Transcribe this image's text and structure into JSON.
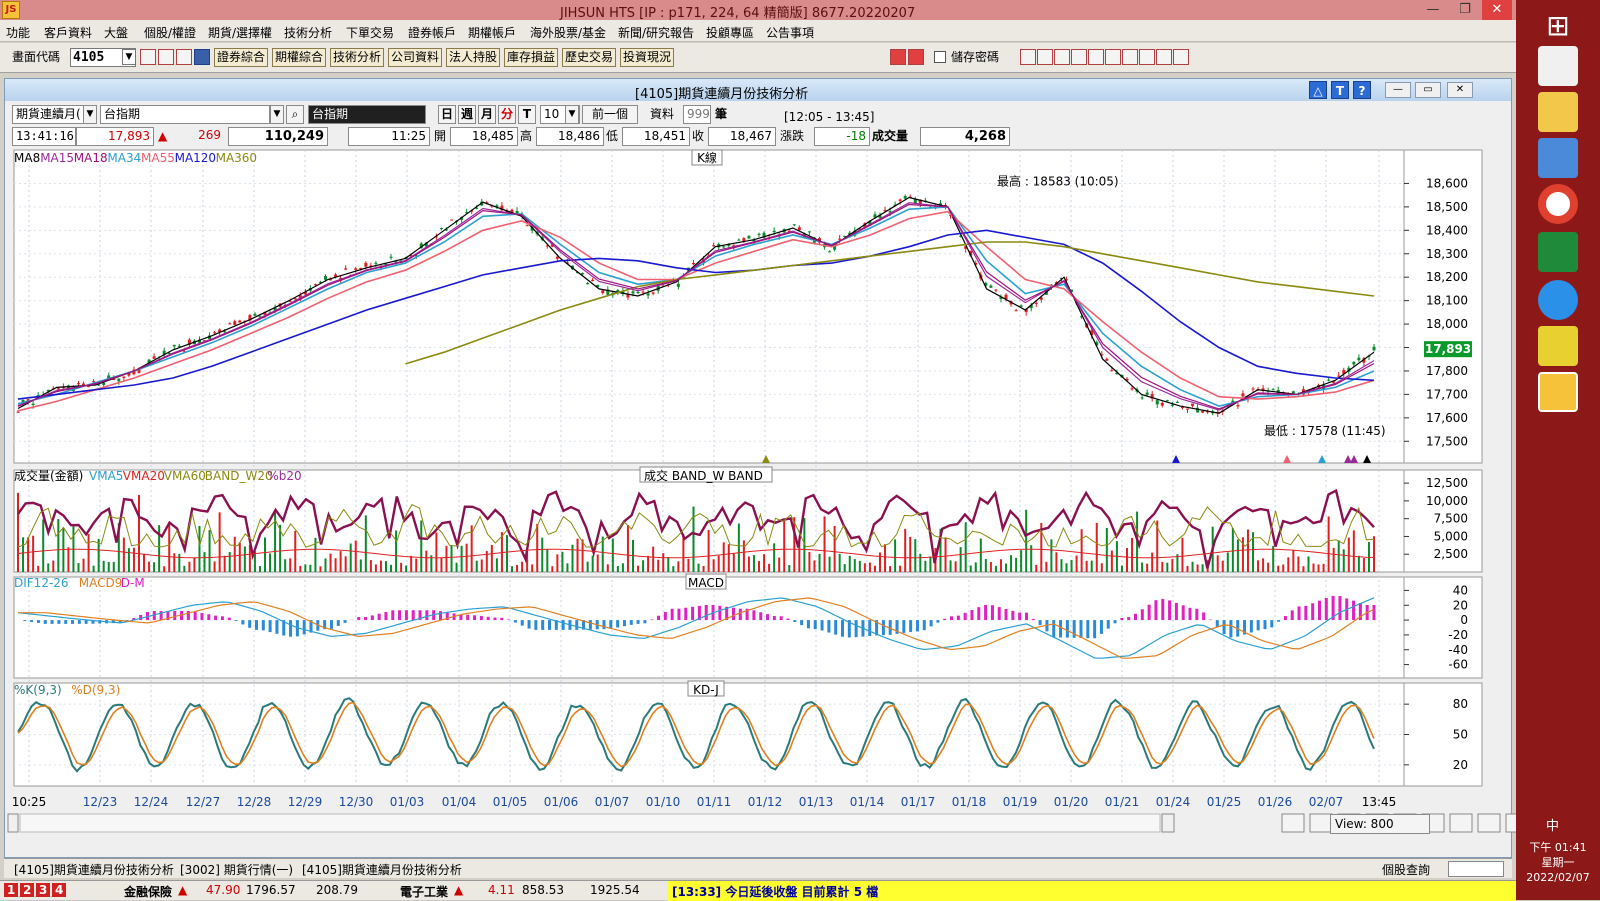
{
  "window": {
    "title": "JIHSUN HTS      [IP : p171, 224, 64 精簡版] 8677.20220207",
    "controls": [
      "—",
      "❐",
      "✕"
    ]
  },
  "menu": [
    "功能",
    "客戶資料",
    "大盤",
    "個股/權證",
    "期貨/選擇權",
    "技術分析",
    "下單交易",
    "證券帳戶",
    "期權帳戶",
    "海外股票/基金",
    "新聞/研究報告",
    "投顧專區",
    "公告事項"
  ],
  "toolbar": {
    "code_label": "畫面代碼",
    "code_value": "4105",
    "buttons": [
      "證券綜合",
      "期權綜合",
      "技術分析",
      "公司資料",
      "法人持股",
      "庫存損益",
      "歷史交易",
      "投資現況"
    ],
    "save_password_label": "儲存密碼"
  },
  "subwindow": {
    "title": "[4105]期貨連續月份技術分析",
    "help_buttons": [
      "△",
      "T",
      "?"
    ]
  },
  "controls": {
    "product_type": "期貨連續月(",
    "symbol": "台指期",
    "symbol_dark": "台指期",
    "periods": [
      "日",
      "週",
      "月",
      "分",
      "T"
    ],
    "interval": "10",
    "prev_button": "前一個",
    "data_label": "資料",
    "data_count": "999",
    "unit": "筆",
    "time_range": "[12:05 - 13:45]"
  },
  "quote": {
    "time": "13:41:16",
    "price": "17,893",
    "change_arrow": "▲",
    "change": "269",
    "volume_total": "110,249",
    "bar_time": "11:25",
    "open_label": "開",
    "open": "18,485",
    "high_label": "高",
    "high": "18,486",
    "low_label": "低",
    "low": "18,451",
    "close_label": "收",
    "close": "18,467",
    "chg_label": "漲跌",
    "chg": "-18",
    "vol_label": "成交量",
    "vol": "4,268"
  },
  "tabs": [
    "[4105]期貨連續月份技術分析",
    "[3002] 期貨行情(一)",
    "[4105]期貨連續月份技術分析"
  ],
  "status": {
    "view_label": "View: 800",
    "right_label": "個股查詢",
    "ticker": [
      {
        "name": "金融保險",
        "arrow": "▲",
        "chg": "47.90",
        "val": "1796.57",
        "vol": "208.79"
      },
      {
        "name": "電子工業",
        "arrow": "▲",
        "chg": "4.11",
        "val": "858.53",
        "vol": "1925.54"
      }
    ],
    "news": "[13:33]  今日延後收盤  目前累計 5 檔"
  },
  "clock": {
    "time": "下午 01:41",
    "weekday": "星期一",
    "date": "2022/02/07"
  },
  "ime": "中",
  "chart_data": [
    {
      "type": "line",
      "panel": "K線",
      "legend": [
        "MA8",
        "MA15",
        "MA18",
        "MA34",
        "MA55",
        "MA120",
        "MA360"
      ],
      "legend_colors": [
        "#000000",
        "#9a2a9a",
        "#a0107a",
        "#2aa0d0",
        "#f06070",
        "#1818d0",
        "#8a8a10"
      ],
      "y_ticks": [
        18600,
        18500,
        18400,
        18300,
        18200,
        18100,
        18000,
        17900,
        17800,
        17700,
        17600,
        17500
      ],
      "ylim": [
        17450,
        18700
      ],
      "last_price": "17,893",
      "annotations": [
        {
          "text": "最高 : 18583 (10:05)",
          "value": 18583
        },
        {
          "text": "最低 : 17578 (11:45)",
          "value": 17578
        }
      ],
      "x_labels": [
        "10:25",
        "12/23",
        "12/24",
        "12/27",
        "12/28",
        "12/29",
        "12/30",
        "01/03",
        "01/04",
        "01/05",
        "01/06",
        "01/07",
        "01/10",
        "01/11",
        "01/12",
        "01/13",
        "01/14",
        "01/17",
        "01/18",
        "01/19",
        "01/20",
        "01/21",
        "01/24",
        "01/25",
        "01/26",
        "02/07",
        "13:45"
      ],
      "series": [
        {
          "name": "MA8",
          "values": [
            17640,
            17730,
            17740,
            17800,
            17890,
            17950,
            18020,
            18100,
            18190,
            18240,
            18280,
            18400,
            18520,
            18460,
            18280,
            18150,
            18120,
            18180,
            18330,
            18360,
            18410,
            18330,
            18440,
            18540,
            18500,
            18150,
            18060,
            18200,
            17850,
            17700,
            17650,
            17620,
            17720,
            17700,
            17760,
            17880
          ]
        },
        {
          "name": "MA34",
          "values": [
            17660,
            17700,
            17750,
            17800,
            17860,
            17920,
            17990,
            18070,
            18150,
            18220,
            18260,
            18350,
            18460,
            18470,
            18340,
            18220,
            18170,
            18190,
            18290,
            18340,
            18380,
            18340,
            18410,
            18490,
            18500,
            18270,
            18130,
            18170,
            17960,
            17820,
            17720,
            17650,
            17690,
            17700,
            17730,
            17800
          ]
        },
        {
          "name": "MA55",
          "values": [
            17630,
            17670,
            17720,
            17770,
            17830,
            17890,
            17960,
            18030,
            18110,
            18180,
            18230,
            18310,
            18400,
            18440,
            18370,
            18260,
            18190,
            18190,
            18260,
            18310,
            18360,
            18330,
            18380,
            18450,
            18480,
            18330,
            18190,
            18150,
            18010,
            17880,
            17770,
            17690,
            17680,
            17690,
            17710,
            17760
          ]
        },
        {
          "name": "MA120",
          "values": [
            17680,
            17700,
            17720,
            17740,
            17770,
            17820,
            17880,
            17940,
            18000,
            18060,
            18110,
            18160,
            18210,
            18240,
            18270,
            18280,
            18270,
            18240,
            18220,
            18230,
            18250,
            18260,
            18290,
            18330,
            18380,
            18400,
            18370,
            18340,
            18260,
            18140,
            18010,
            17900,
            17820,
            17790,
            17770,
            17760
          ]
        },
        {
          "name": "MA360",
          "values": [
            null,
            null,
            null,
            null,
            null,
            null,
            null,
            null,
            null,
            null,
            17830,
            17880,
            17940,
            18000,
            18060,
            18110,
            18160,
            18190,
            18210,
            18230,
            18250,
            18270,
            18290,
            18310,
            18330,
            18350,
            18350,
            18330,
            18300,
            18270,
            18240,
            18210,
            18180,
            18160,
            18140,
            18120
          ]
        }
      ]
    },
    {
      "type": "bar",
      "panel": "成交量(金額)",
      "legend": [
        "成交量(金額)",
        "VMA5",
        "VMA20",
        "VMA60",
        "BAND_W20",
        "%b20"
      ],
      "legend_colors": [
        "#000000",
        "#2aa0d0",
        "#e02020",
        "#8a8a10",
        "#8a8a10",
        "#9a2a9a"
      ],
      "header": "成交  BAND_W  BAND",
      "y_ticks": [
        "12,500",
        "10,000",
        "7,500",
        "5,000",
        "2,500"
      ],
      "ylim": [
        0,
        13500
      ]
    },
    {
      "type": "line",
      "panel": "MACD",
      "legend": [
        "DIF12-26",
        "MACD9",
        "D-M"
      ],
      "legend_colors": [
        "#2aa0d0",
        "#e08020",
        "#e020c0"
      ],
      "y_ticks": [
        40,
        20,
        0,
        -20,
        -40,
        -60
      ],
      "ylim": [
        -70,
        50
      ]
    },
    {
      "type": "line",
      "panel": "KD-J",
      "legend": [
        "%K(9,3)",
        "%D(9,3)"
      ],
      "legend_colors": [
        "#2a7a7a",
        "#e08020"
      ],
      "y_ticks": [
        80,
        50,
        20
      ],
      "ylim": [
        5,
        95
      ]
    }
  ]
}
